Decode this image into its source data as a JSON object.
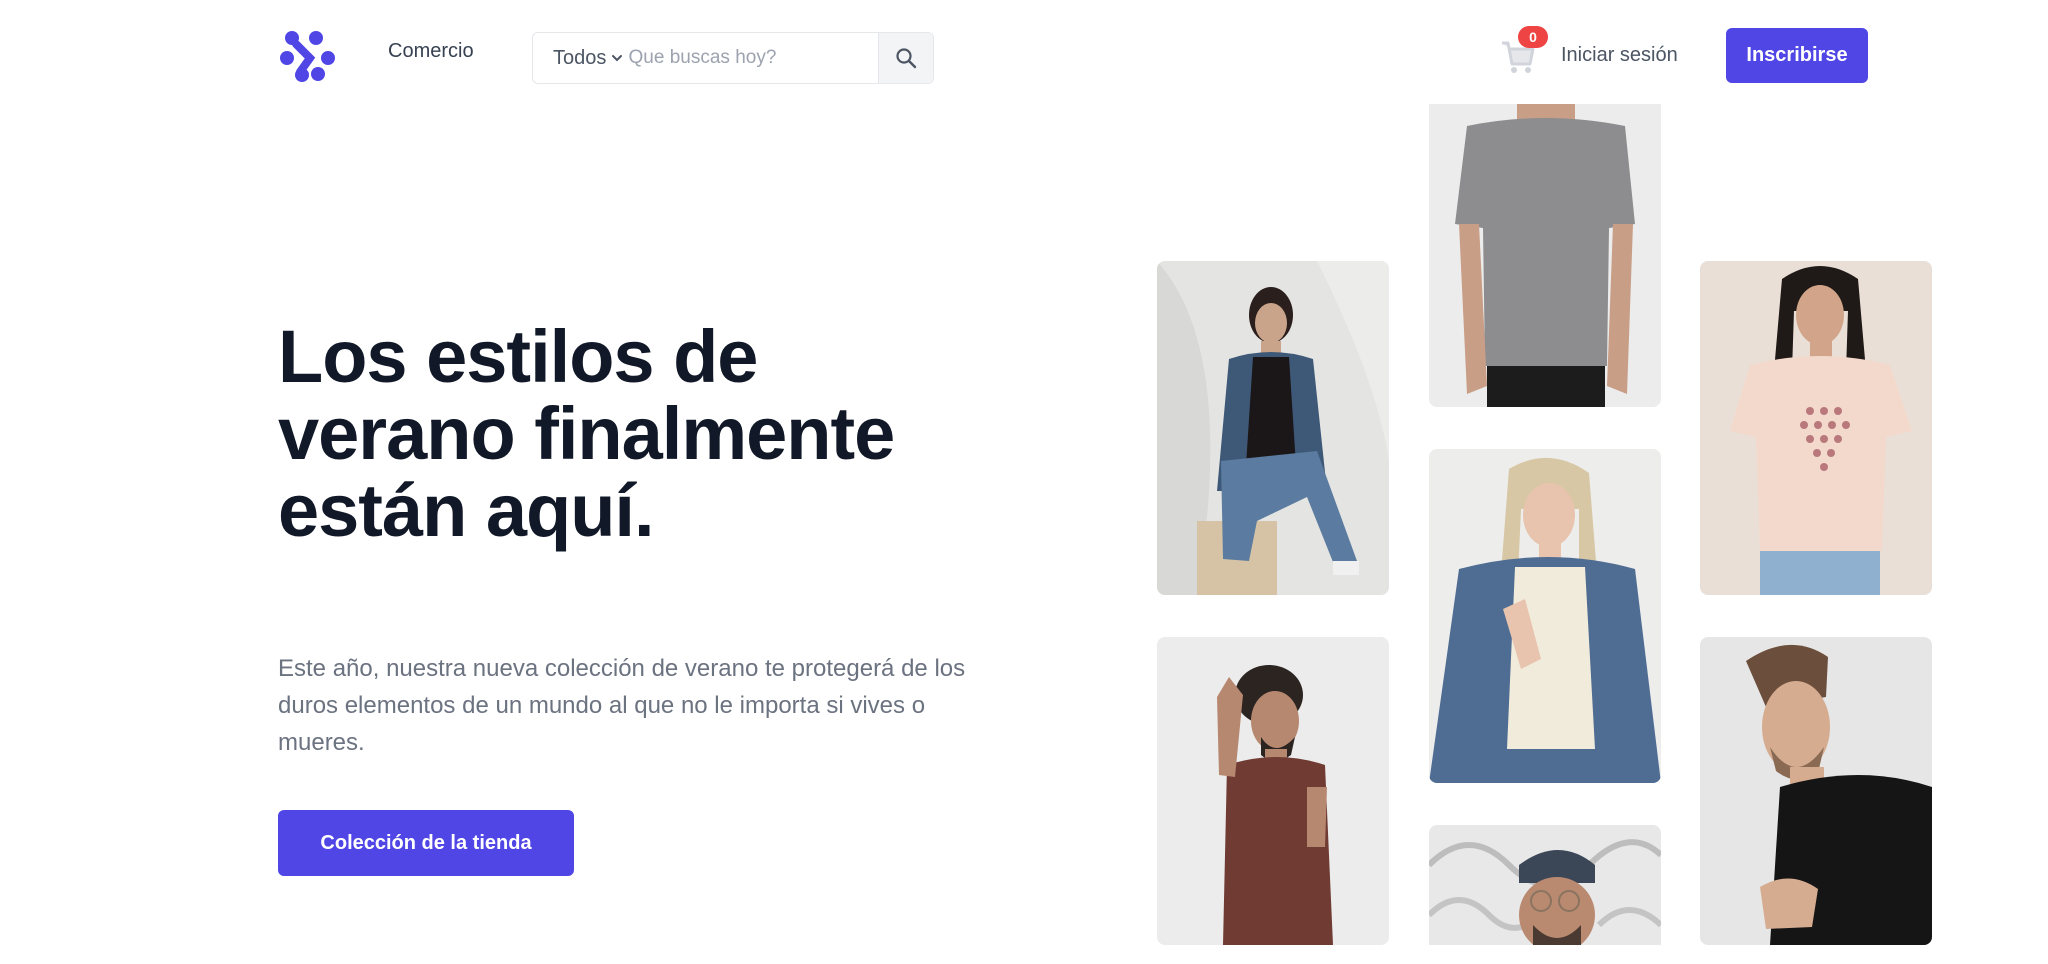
{
  "header": {
    "nav_link": "Comercio",
    "search": {
      "category": "Todos",
      "placeholder": "Que buscas hoy?"
    },
    "cart_count": "0",
    "signin_label": "Iniciar sesión",
    "signup_label": "Inscribirse"
  },
  "hero": {
    "title": "Los estilos de verano finalmente están aquí.",
    "description": "Este año, nuestra nueva colección de verano te protegerá de los duros elementos de un mundo al que no le importa si vives o mueres.",
    "cta_label": "Colección de la tienda"
  },
  "colors": {
    "accent": "#4f46e5",
    "badge": "#ef4444",
    "heading": "#111827",
    "body": "#6b7280"
  },
  "images": [
    {
      "name": "woman-denim-jacket-photo"
    },
    {
      "name": "man-gray-tshirt-photo"
    },
    {
      "name": "woman-pink-tshirt-photo"
    },
    {
      "name": "woman-cream-top-photo"
    },
    {
      "name": "man-brown-tshirt-photo"
    },
    {
      "name": "man-black-tshirt-photo"
    },
    {
      "name": "man-beanie-glasses-photo"
    }
  ]
}
